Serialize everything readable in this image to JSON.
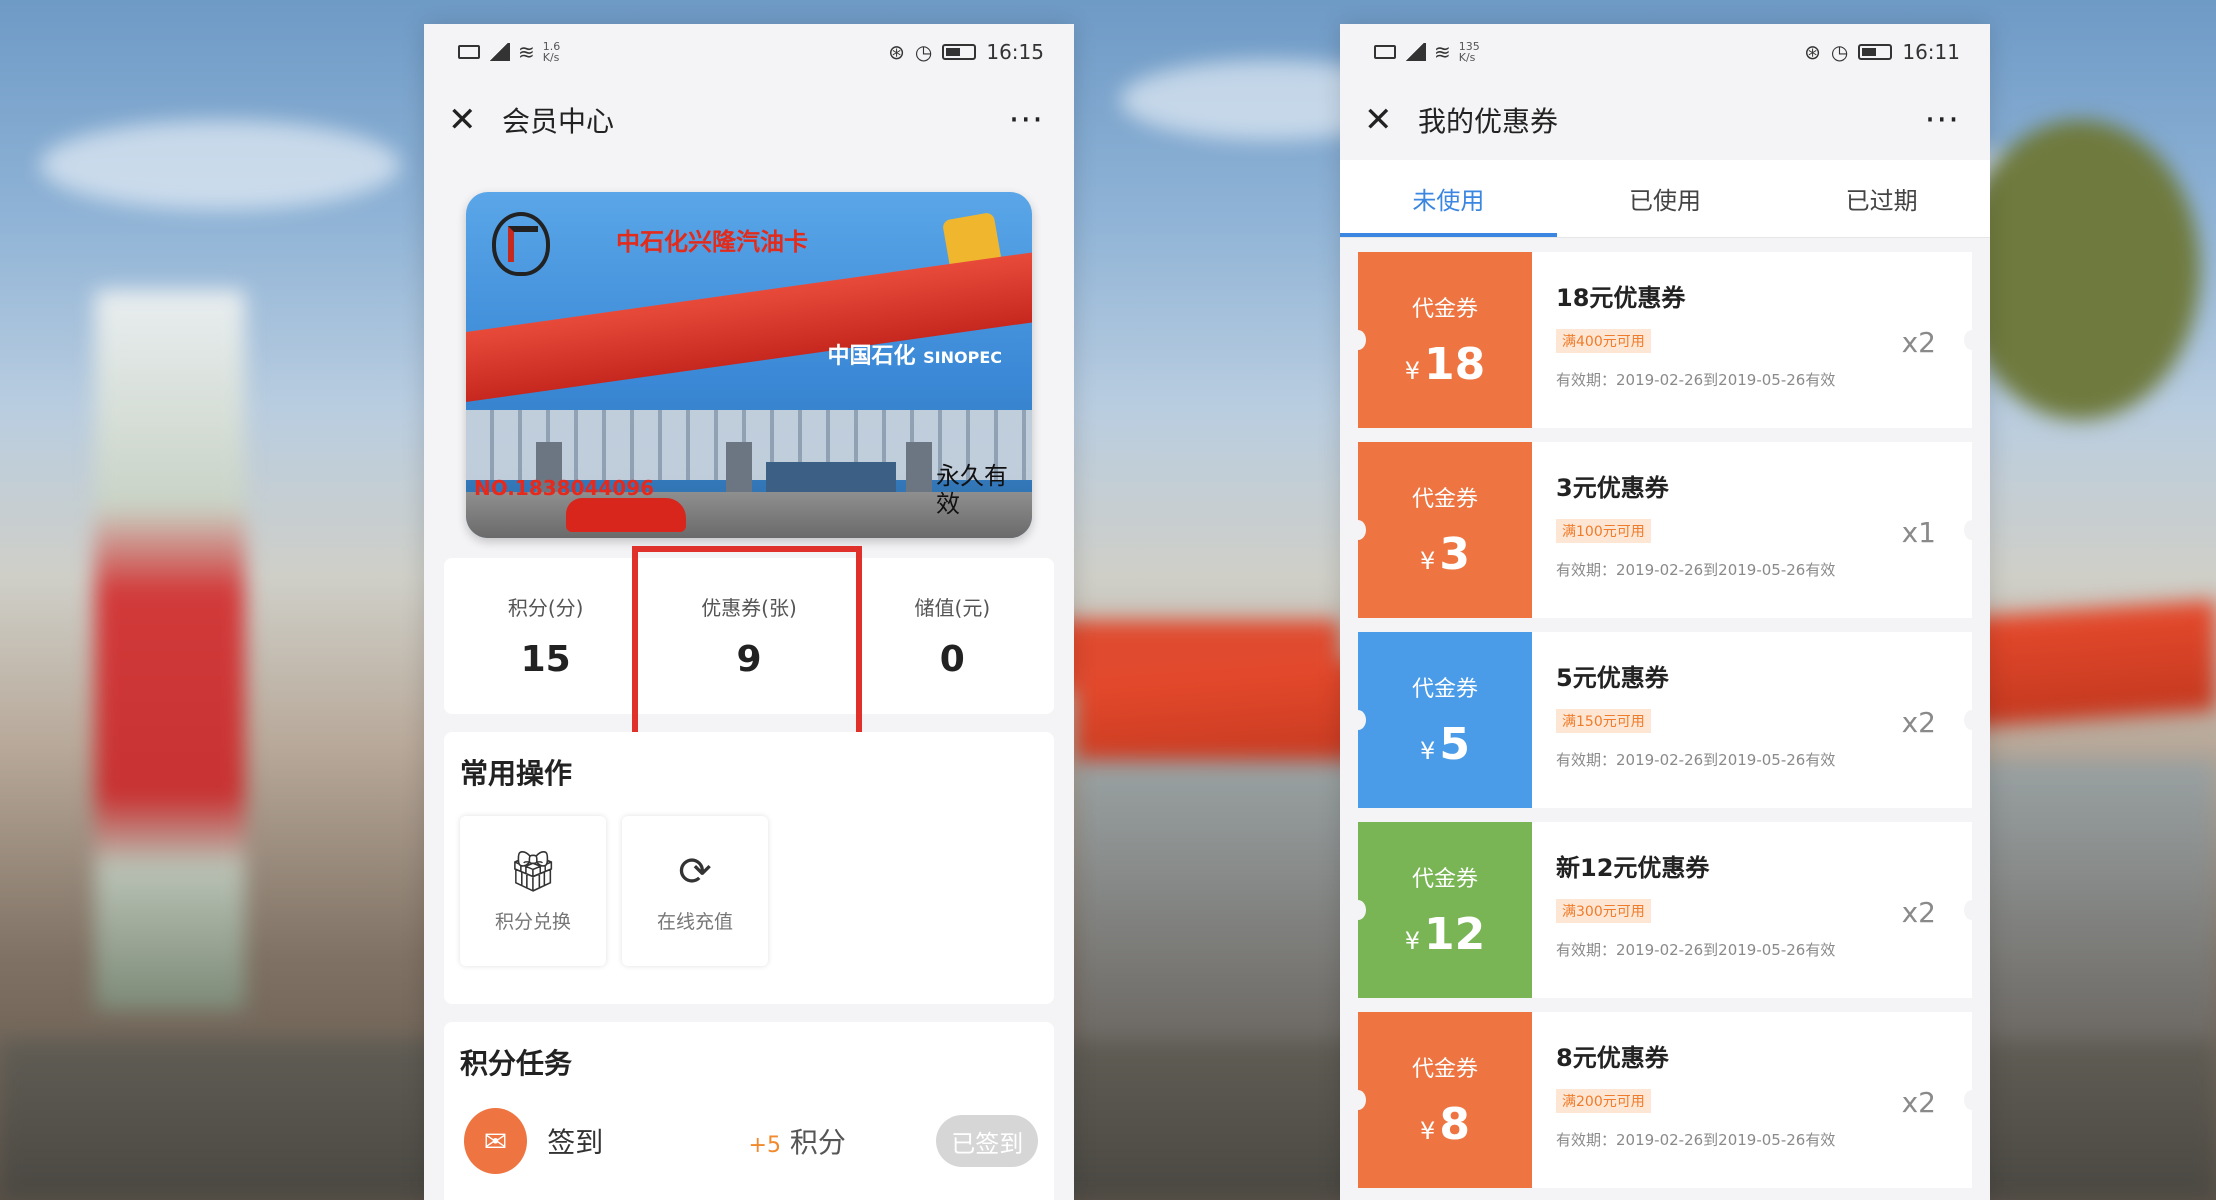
{
  "left": {
    "status": {
      "net_speed_top": "1.6",
      "net_speed_unit": "K/s",
      "time": "16:15"
    },
    "title": "会员中心",
    "card": {
      "name": "中石化兴隆汽油卡",
      "brand_cn": "中国石化",
      "brand_en": "SINOPEC",
      "card_no": "NO.1838044096",
      "permanent": "永久有效"
    },
    "stats": [
      {
        "label": "积分(分)",
        "value": "15"
      },
      {
        "label": "优惠券(张)",
        "value": "9"
      },
      {
        "label": "储值(元)",
        "value": "0"
      }
    ],
    "common_ops_title": "常用操作",
    "ops": [
      {
        "label": "积分兑换",
        "icon": "gift-icon"
      },
      {
        "label": "在线充值",
        "icon": "yen-recharge-icon"
      }
    ],
    "tasks_title": "积分任务",
    "task": {
      "name": "签到",
      "plus": "+5",
      "points_label": "积分",
      "button": "已签到"
    }
  },
  "right": {
    "status": {
      "net_speed_top": "135",
      "net_speed_unit": "K/s",
      "time": "16:11"
    },
    "title": "我的优惠券",
    "tabs": [
      "未使用",
      "已使用",
      "已过期"
    ],
    "coupons": [
      {
        "type": "代金券",
        "yen": "¥",
        "amount": "18",
        "name": "18元优惠券",
        "condition": "满400元可用",
        "valid": "有效期：2019-02-26到2019-05-26有效",
        "qty": "x2",
        "color": "#ee7541"
      },
      {
        "type": "代金券",
        "yen": "¥",
        "amount": "3",
        "name": "3元优惠券",
        "condition": "满100元可用",
        "valid": "有效期：2019-02-26到2019-05-26有效",
        "qty": "x1",
        "color": "#ee7541"
      },
      {
        "type": "代金券",
        "yen": "¥",
        "amount": "5",
        "name": "5元优惠券",
        "condition": "满150元可用",
        "valid": "有效期：2019-02-26到2019-05-26有效",
        "qty": "x2",
        "color": "#4a9be8"
      },
      {
        "type": "代金券",
        "yen": "¥",
        "amount": "12",
        "name": "新12元优惠券",
        "condition": "满300元可用",
        "valid": "有效期：2019-02-26到2019-05-26有效",
        "qty": "x2",
        "color": "#79b555"
      },
      {
        "type": "代金券",
        "yen": "¥",
        "amount": "8",
        "name": "8元优惠券",
        "condition": "满200元可用",
        "valid": "有效期：2019-02-26到2019-05-26有效",
        "qty": "x2",
        "color": "#ee7541"
      }
    ]
  },
  "colors": {
    "accent_blue": "#3a86e0",
    "highlight_red": "#e0302a"
  }
}
